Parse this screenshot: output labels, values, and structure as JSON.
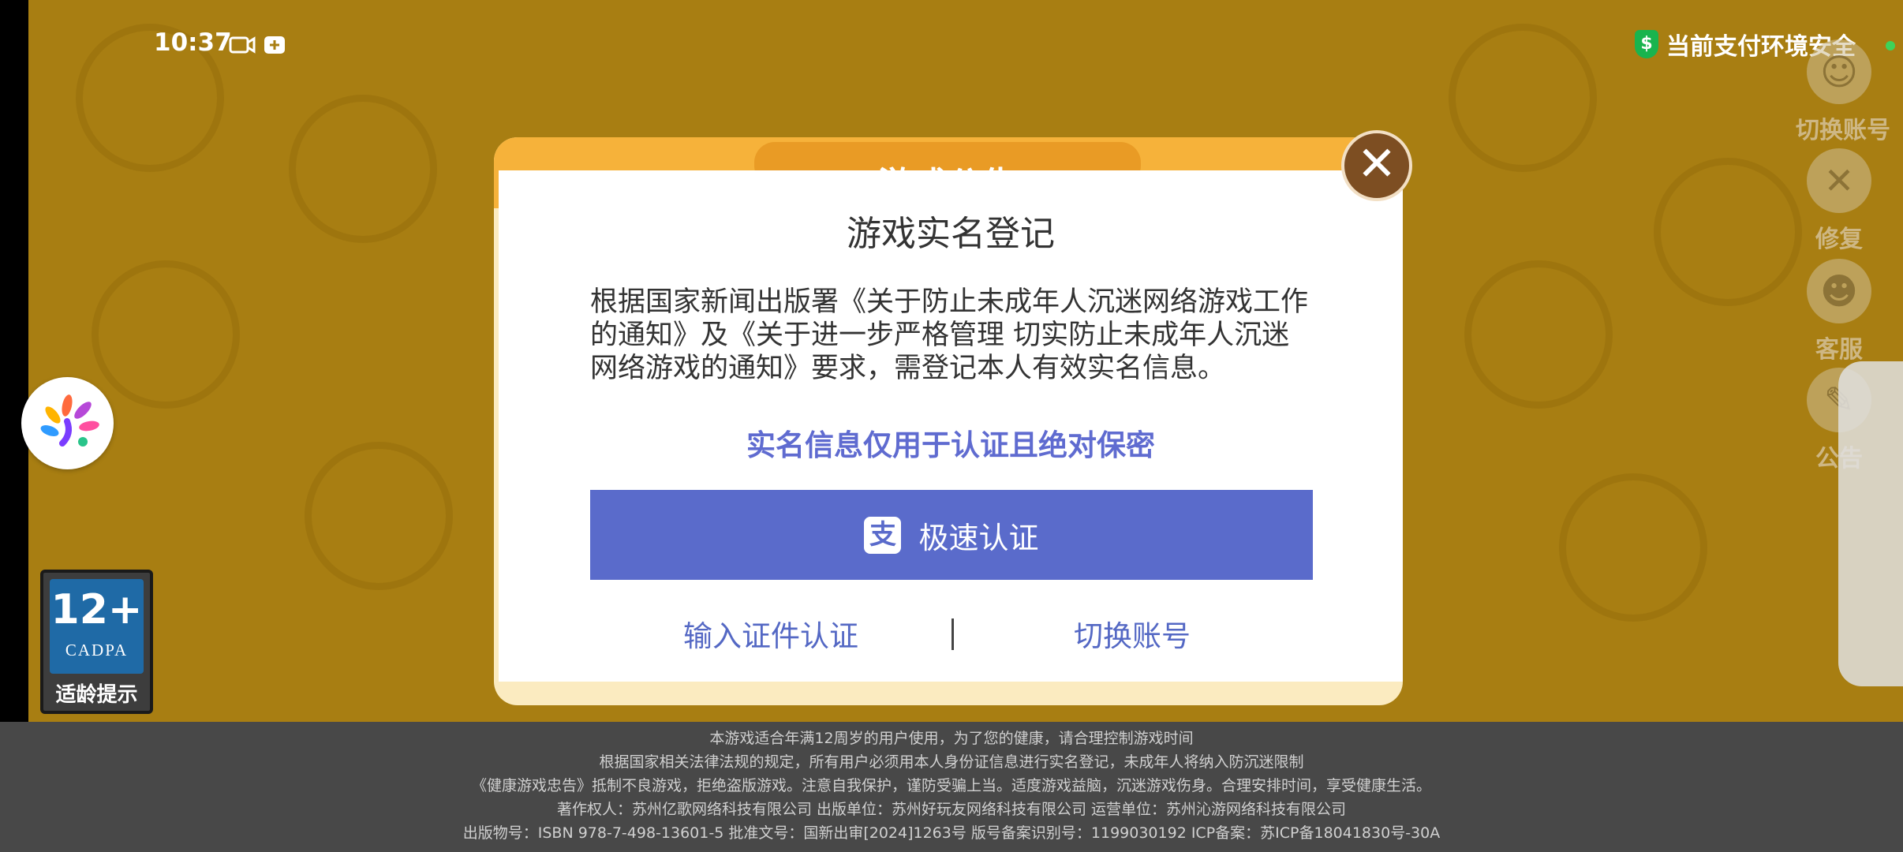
{
  "status_bar": {
    "time": "10:37",
    "icons": [
      "video-recording-icon",
      "plus-box-icon"
    ],
    "pay_safe_text": "当前支付环境安全"
  },
  "side_menu": {
    "items": [
      {
        "label": "切换账号",
        "icon": "avatar-icon"
      },
      {
        "label": "修复",
        "icon": "wrench-screwdriver-icon"
      },
      {
        "label": "客服",
        "icon": "customer-service-icon"
      },
      {
        "label": "公告",
        "icon": "notice-icon"
      }
    ]
  },
  "notice": {
    "title": "游戏公告"
  },
  "dialog": {
    "title": "游戏实名登记",
    "description": "根据国家新闻出版署《关于防止未成年人沉迷网络游戏工作的通知》及《关于进一步严格管理 切实防止未成年人沉迷网络游戏的通知》要求，需登记本人有效实名信息。",
    "secure_note": "实名信息仅用于认证且绝对保密",
    "quick_button_label": "极速认证",
    "id_auth_label": "输入证件认证",
    "switch_account_label": "切换账号",
    "close_label": "✕"
  },
  "age_badge": {
    "rating": "12+",
    "org": "CADPA",
    "label": "适龄提示"
  },
  "footer": {
    "lines": [
      "本游戏适合年满12周岁的用户使用，为了您的健康，请合理控制游戏时间",
      "根据国家相关法律法规的规定，所有用户必须用本人身份证信息进行实名登记，未成年人将纳入防沉迷限制",
      "《健康游戏忠告》抵制不良游戏，拒绝盗版游戏。注意自我保护，谨防受骗上当。适度游戏益脑，沉迷游戏伤身。合理安排时间，享受健康生活。",
      "著作权人：苏州亿歌网络科技有限公司 出版单位：苏州好玩友网络科技有限公司 运营单位：苏州沁游网络科技有限公司",
      "出版物号：ISBN 978-7-498-13601-5 批准文号：国新出审[2024]1263号 版号备案识别号：1199030192 ICP备案：苏ICP备18041830号-30A"
    ]
  },
  "colors": {
    "primary": "#5a6bcb",
    "link": "#5468c4",
    "notice_header": "#f6b23a",
    "background": "#a87e12"
  }
}
